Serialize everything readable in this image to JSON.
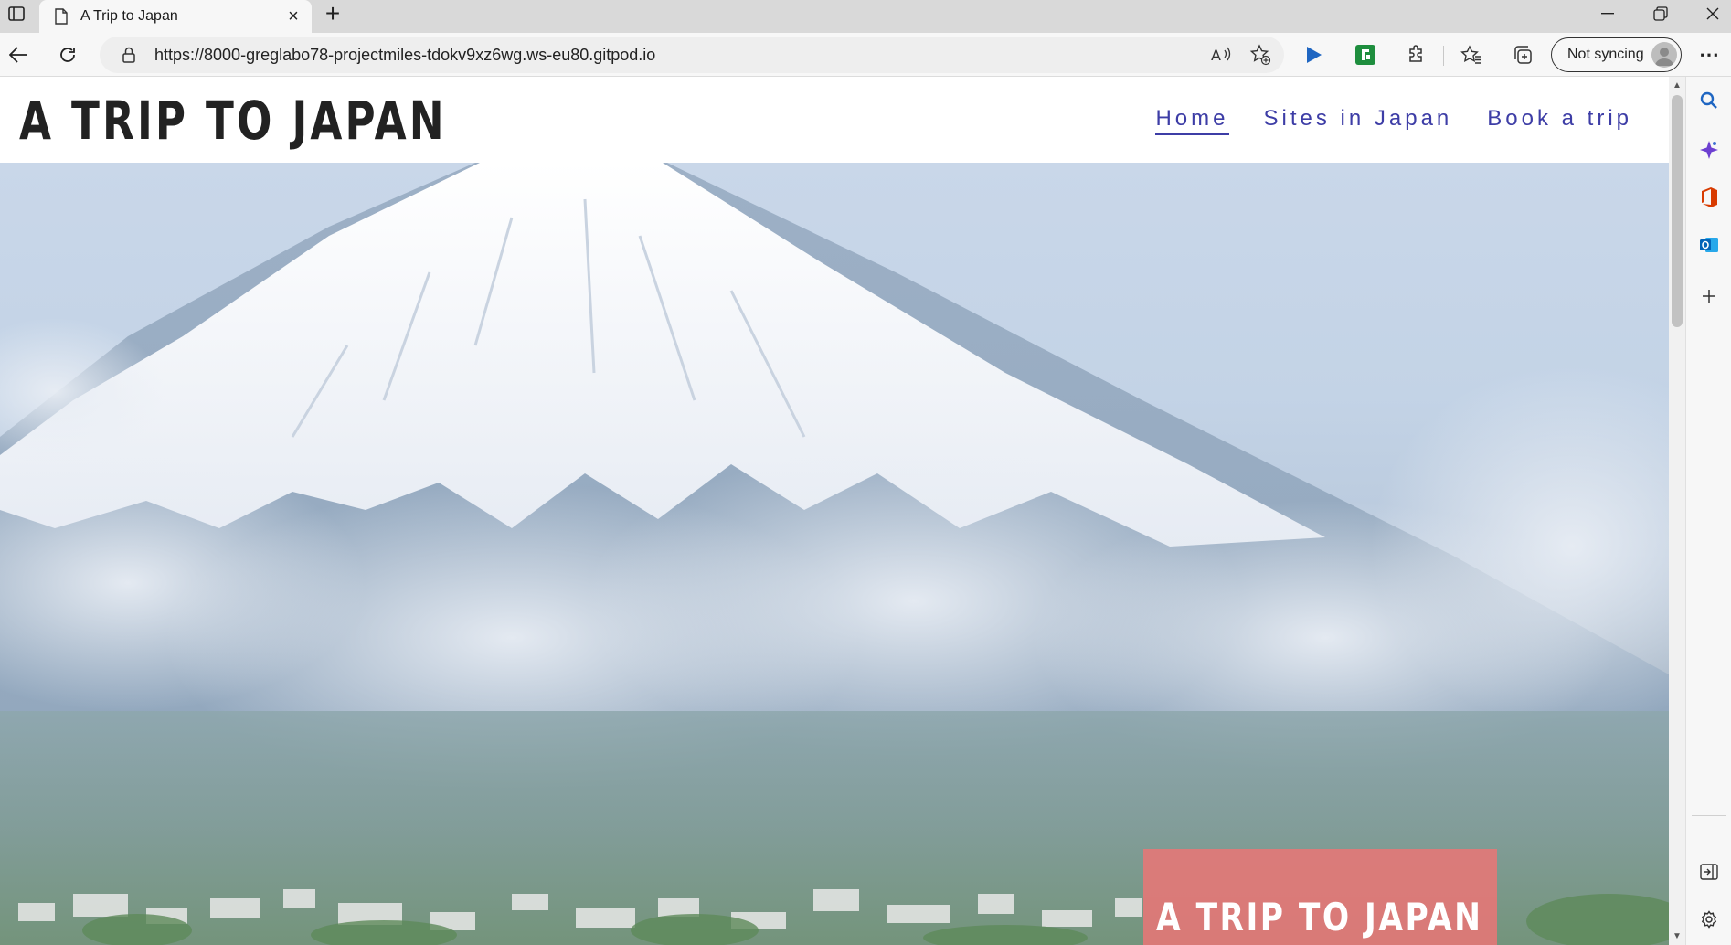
{
  "browser": {
    "tab": {
      "title": "A Trip to Japan",
      "close_glyph": "×"
    },
    "new_tab_glyph": "+",
    "window_controls": {
      "minimize": "—",
      "restore": "❐",
      "close": "✕"
    },
    "address": {
      "url": "https://8000-greglabo78-projectmiles-tdokv9xz6wg.ws-eu80.gitpod.io"
    },
    "profile": {
      "label": "Not syncing"
    },
    "more_glyph": "⋯"
  },
  "site": {
    "logo": "A TRIP TO JAPAN",
    "nav": [
      {
        "label": "Home",
        "active": true
      },
      {
        "label": "Sites in Japan",
        "active": false
      },
      {
        "label": "Book a trip",
        "active": false
      }
    ],
    "hero_title": "A TRIP TO JAPAN"
  },
  "colors": {
    "nav_link": "#3d3da6",
    "hero_box": "#e77676",
    "logo": "#222222"
  },
  "icons": {
    "tab_actions": "tab-actions-icon",
    "page": "page-icon",
    "back": "back-arrow-icon",
    "refresh": "refresh-icon",
    "lock": "lock-icon",
    "read_aloud": "read-aloud-icon",
    "favorite": "add-favorite-icon",
    "extensions": [
      "play-extension-icon",
      "green-extension-icon",
      "puzzle-extensions-icon"
    ],
    "favorites": "favorites-icon",
    "collections": "collections-icon",
    "sidebar": [
      "search-icon",
      "copilot-icon",
      "office-icon",
      "outlook-icon",
      "add-icon",
      "hide-sidebar-icon",
      "settings-icon"
    ]
  }
}
